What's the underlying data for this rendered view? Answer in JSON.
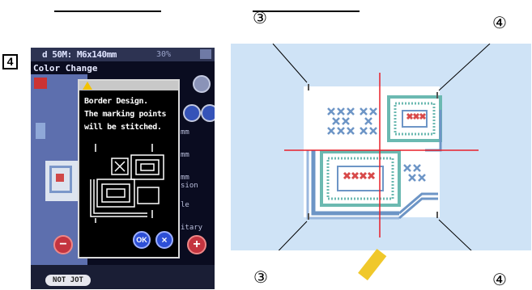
{
  "step_number": "4",
  "screen": {
    "status_text": "d 50M: M6x140mm",
    "status_right": "30%",
    "title": "Color Change",
    "side_labels": [
      "mm",
      "mm",
      "mm",
      "sion",
      "le",
      "itary"
    ],
    "bottom_pill": "NOT JOT"
  },
  "dialog": {
    "lines": [
      "Border Design.",
      "The marking points",
      "will be stitched."
    ],
    "ok_label": "OK",
    "cancel_label": "×"
  },
  "callouts": {
    "top_left": "③",
    "top_right": "④",
    "bottom_left": "③",
    "bottom_right": "④"
  },
  "colors": {
    "background_blue": "#cfe3f6",
    "crosshair_red": "#e8202a",
    "lcd_dark": "#0a0c20",
    "stitch_blue": "#5d87bd",
    "stitch_teal": "#5fb8b0",
    "stitch_red": "#d84a4a"
  }
}
